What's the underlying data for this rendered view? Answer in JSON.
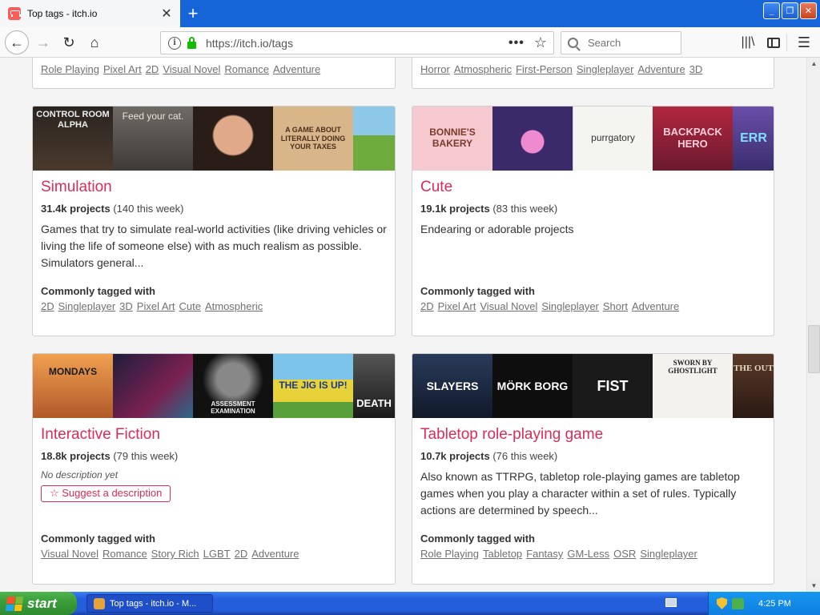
{
  "browser": {
    "tab_title": "Top tags - itch.io",
    "url": "https://itch.io/tags",
    "search_placeholder": "Search",
    "page_actions": "•••"
  },
  "top_cards": [
    {
      "tags": [
        "Role Playing",
        "Pixel Art",
        "2D",
        "Visual Novel",
        "Romance",
        "Adventure"
      ]
    },
    {
      "tags": [
        "Horror",
        "Atmospheric",
        "First-Person",
        "Singleplayer",
        "Adventure",
        "3D"
      ]
    }
  ],
  "cards": [
    {
      "title": "Simulation",
      "projects": "31.4k projects",
      "week": "(140 this week)",
      "description": "Games that try to simulate real-world activities (like driving vehicles or living the life of someone else) with as much realism as possible. Simulators general...",
      "common_label": "Commonly tagged with",
      "tags": [
        "2D",
        "Singleplayer",
        "3D",
        "Pixel Art",
        "Cute",
        "Atmospheric"
      ],
      "thumbs": [
        "CONTROL ROOM ALPHA",
        "Feed your cat.",
        "",
        "A GAME ABOUT LITERALLY DOING YOUR TAXES",
        ""
      ]
    },
    {
      "title": "Cute",
      "projects": "19.1k projects",
      "week": "(83 this week)",
      "description": "Endearing or adorable projects",
      "common_label": "Commonly tagged with",
      "tags": [
        "2D",
        "Pixel Art",
        "Visual Novel",
        "Singleplayer",
        "Short",
        "Adventure"
      ],
      "thumbs": [
        "BONNIE'S BAKERY",
        "",
        "purrgatory",
        "BACKPACK HERO",
        "ERR"
      ]
    },
    {
      "title": "Interactive Fiction",
      "projects": "18.8k projects",
      "week": "(79 this week)",
      "no_description": "No description yet",
      "suggest_label": "Suggest a description",
      "common_label": "Commonly tagged with",
      "tags": [
        "Visual Novel",
        "Romance",
        "Story Rich",
        "LGBT",
        "2D",
        "Adventure"
      ],
      "thumbs": [
        "MONDAYS",
        "",
        "ASSESSMENT EXAMINATION",
        "THE JIG IS UP!",
        "DEATH"
      ]
    },
    {
      "title": "Tabletop role-playing game",
      "projects": "10.7k projects",
      "week": "(76 this week)",
      "description": "Also known as TTRPG, tabletop role-playing games are tabletop games when you play a character within a set of rules. Typically actions are determined by speech...",
      "common_label": "Commonly tagged with",
      "tags": [
        "Role Playing",
        "Tabletop",
        "Fantasy",
        "GM-Less",
        "OSR",
        "Singleplayer"
      ],
      "thumbs": [
        "SLAYERS",
        "MÖRK BORG",
        "FIST",
        "SWORN BY GHOSTLIGHT",
        "THE OUT"
      ]
    }
  ],
  "taskbar": {
    "start_label": "start",
    "task_label": "Top tags - itch.io - M...",
    "clock": "4:25 PM"
  },
  "colors": {
    "accent": "#da2c56",
    "tab_bar": "#1565d8",
    "taskbar": "#245edb",
    "start": "#3a9e3a"
  }
}
